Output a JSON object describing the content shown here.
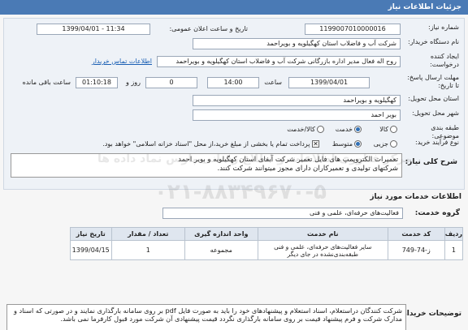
{
  "header": {
    "title": "جزئیات اطلاعات نیاز"
  },
  "fields": {
    "need_number_label": "شماره نیاز:",
    "need_number": "1199007010000016",
    "announce_label": "تاریخ و ساعت اعلان عمومی:",
    "announce_value": "1399/04/01 - 11:34",
    "buyer_label": "نام دستگاه خریدار:",
    "buyer_value": "شرکت آب و فاضلاب استان کهگیلویه و بویراحمد",
    "creator_label": "ایجاد کننده درخواست:",
    "creator_value": "روح اله فعال مدیر اداره بازرگانی شرکت آب و فاضلاب استان کهگیلویه و بویراحمد",
    "contact_link": "اطلاعات تماس خریدار",
    "deadline_label": "مهلت ارسال پاسخ: تا تاریخ:",
    "deadline_date": "1399/04/01",
    "time_label": "ساعت",
    "deadline_time": "14:00",
    "day_label": "روز و",
    "days": "0",
    "remaining_time": "01:10:18",
    "remaining_label": "ساعت باقی مانده",
    "province_label": "استان محل تحویل:",
    "province_value": "کهگیلویه و بویراحمد",
    "city_label": "شهر محل تحویل:",
    "city_value": "بویر احمد",
    "category_label": "طبقه بندی موضوعی:",
    "category_options": [
      "کالا",
      "خدمت",
      "کالا/خدمت"
    ],
    "process_label": "نوع فرآیند خرید:",
    "process_options": [
      "جزیی",
      "متوسط"
    ],
    "payment_text": "پرداخت تمام یا بخشی از مبلغ خرید،از محل \"اسناد خزانه اسلامی\" خواهد بود."
  },
  "description": {
    "label": "شرح کلی نیاز:",
    "text": "تعمیرات الکتروپمپ های فایل تعمیر شرکت آبفای استان کهگیلویه و بویر احمد\nشرکتهای تولیدی و تعمیرکاران دارای مجوز میتوانند شرکت کنند."
  },
  "services": {
    "section_title": "اطلاعات خدمات مورد نیاز",
    "group_label": "گروه خدمت:",
    "group_value": "فعالیت‌های حرفه‌ای، علمی و فنی",
    "columns": [
      "ردیف",
      "کد خدمت",
      "نام خدمت",
      "واحد اندازه گیری",
      "تعداد / مقدار",
      "تاریخ نیاز"
    ],
    "rows": [
      [
        "1",
        "ز-74-749",
        "سایر فعالیت‌های حرفه‌ای، علمی و فنی طبقه‌بندی‌نشده در جای دیگر",
        "مجموعه",
        "1",
        "1399/04/15"
      ]
    ]
  },
  "note": {
    "label": "توضیحات خریدار:",
    "text": "شرکت کنندگان دراستعلام، اسناد استعلام و پیشنهادهای خود را باید به صورت فایل pdf بر روی سامانه بارگذاری نمایند و در صورتی که اسناد و مدارک شرکت و فرم پیشنهاد قیمت بر روی سامانه بارگذاری نگردد قیمت پیشنهادی آن شرکت مورد قبول کارفرما نمی باشد."
  },
  "watermark": {
    "line1": "مرکز فناوری اطلاعات و اطلاع رسانی پارس نماد داده ها",
    "line2": "۰۲۱-۸۸۳۴۹۶۷۰-۵"
  }
}
